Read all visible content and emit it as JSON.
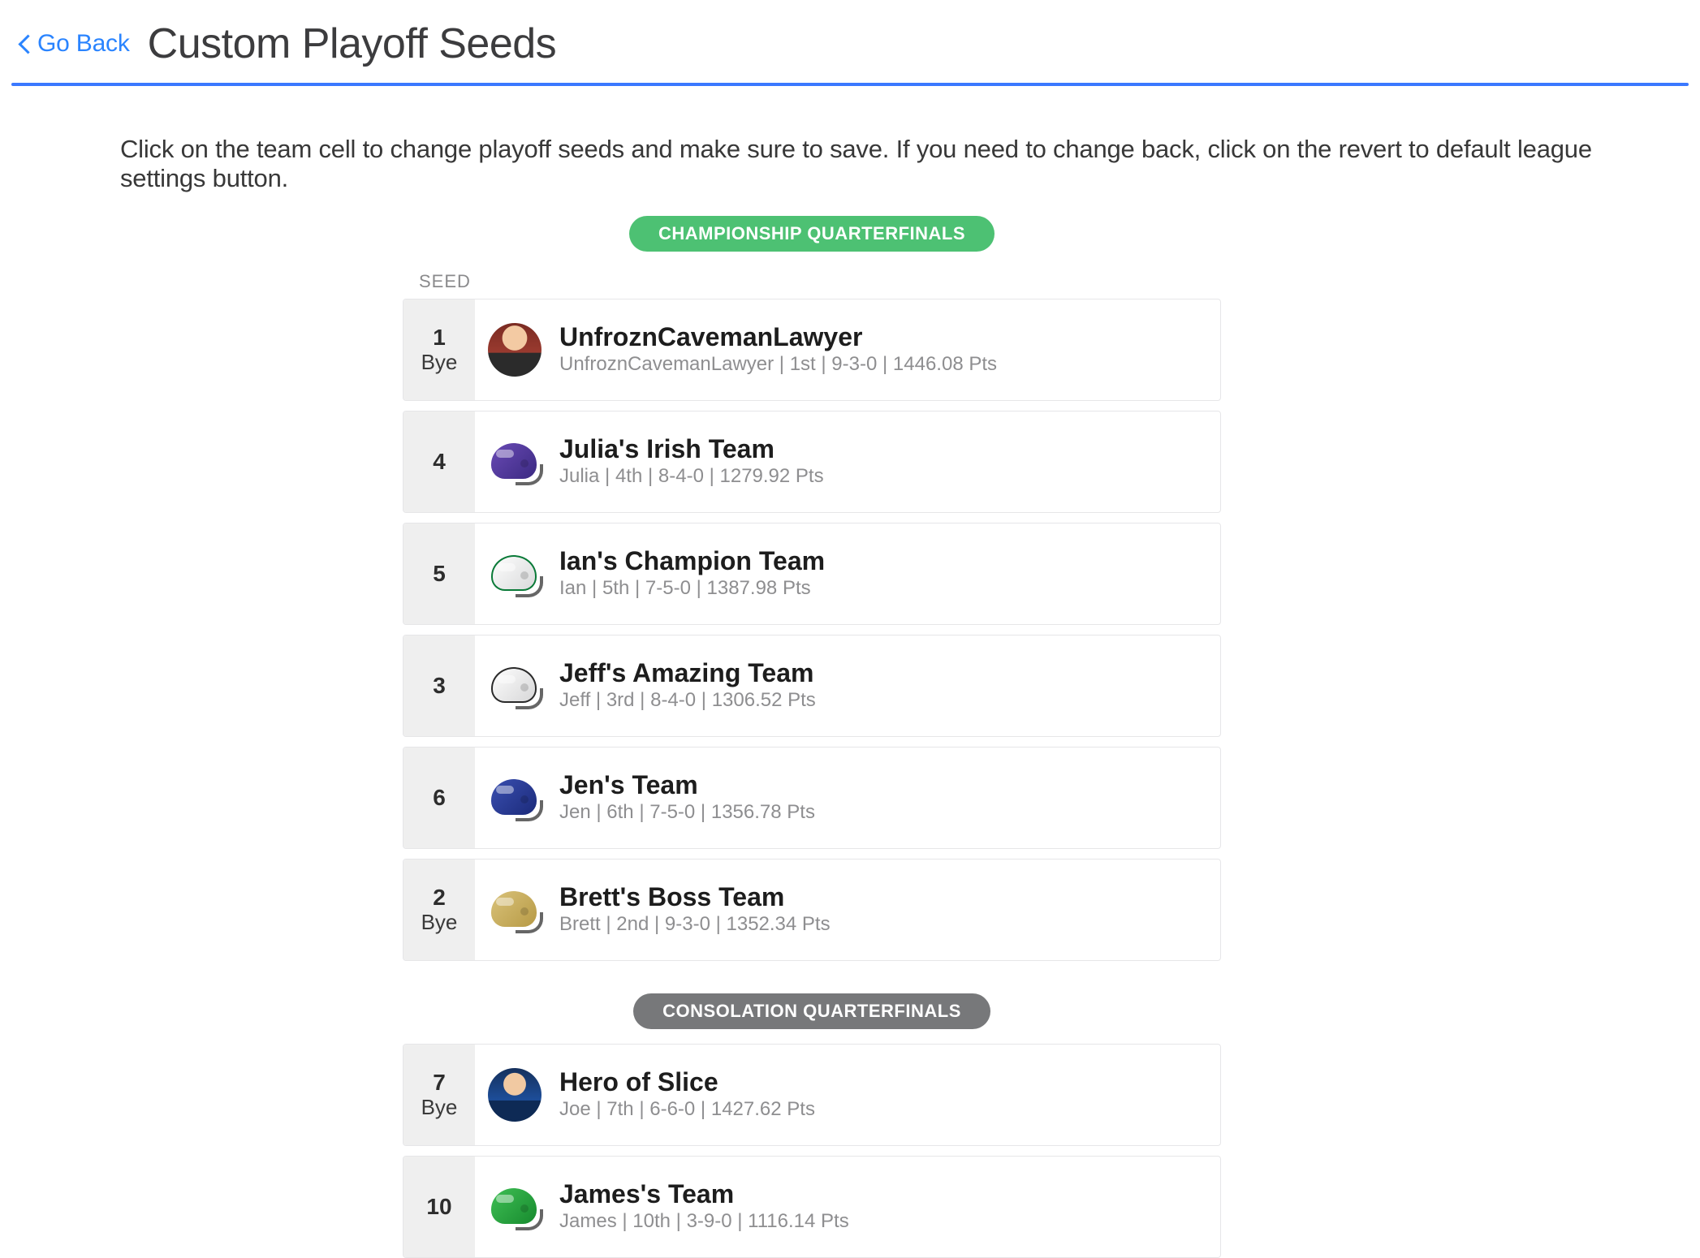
{
  "header": {
    "back_label": "Go Back",
    "title": "Custom Playoff Seeds"
  },
  "instructions": "Click on the team cell to change playoff seeds and make sure to save. If you need to change back, click on the revert to default league settings button.",
  "labels": {
    "seed_column": "SEED",
    "bye": "Bye"
  },
  "sections": [
    {
      "id": "championship",
      "title": "CHAMPIONSHIP QUARTERFINALS",
      "style": "green",
      "rows": [
        {
          "seed": "1",
          "bye": true,
          "icon": "avatar-man1",
          "team": "UnfroznCavemanLawyer",
          "manager": "UnfroznCavemanLawyer",
          "rank": "1st",
          "record": "9-3-0",
          "pts": "1446.08 Pts"
        },
        {
          "seed": "4",
          "bye": false,
          "icon": "helmet-purple",
          "team": "Julia's Irish Team",
          "manager": "Julia",
          "rank": "4th",
          "record": "8-4-0",
          "pts": "1279.92 Pts"
        },
        {
          "seed": "5",
          "bye": false,
          "icon": "helmet-white",
          "team": "Ian's Champion Team",
          "manager": "Ian",
          "rank": "5th",
          "record": "7-5-0",
          "pts": "1387.98 Pts"
        },
        {
          "seed": "3",
          "bye": false,
          "icon": "helmet-whiteb",
          "team": "Jeff's Amazing Team",
          "manager": "Jeff",
          "rank": "3rd",
          "record": "8-4-0",
          "pts": "1306.52 Pts"
        },
        {
          "seed": "6",
          "bye": false,
          "icon": "helmet-navy",
          "team": "Jen's Team",
          "manager": "Jen",
          "rank": "6th",
          "record": "7-5-0",
          "pts": "1356.78 Pts"
        },
        {
          "seed": "2",
          "bye": true,
          "icon": "helmet-gold",
          "team": "Brett's Boss Team",
          "manager": "Brett",
          "rank": "2nd",
          "record": "9-3-0",
          "pts": "1352.34 Pts"
        }
      ]
    },
    {
      "id": "consolation",
      "title": "CONSOLATION QUARTERFINALS",
      "style": "grey",
      "rows": [
        {
          "seed": "7",
          "bye": true,
          "icon": "avatar-man2",
          "team": "Hero of Slice",
          "manager": "Joe",
          "rank": "7th",
          "record": "6-6-0",
          "pts": "1427.62 Pts"
        },
        {
          "seed": "10",
          "bye": false,
          "icon": "helmet-green",
          "team": "James's Team",
          "manager": "James",
          "rank": "10th",
          "record": "3-9-0",
          "pts": "1116.14 Pts"
        }
      ]
    }
  ]
}
